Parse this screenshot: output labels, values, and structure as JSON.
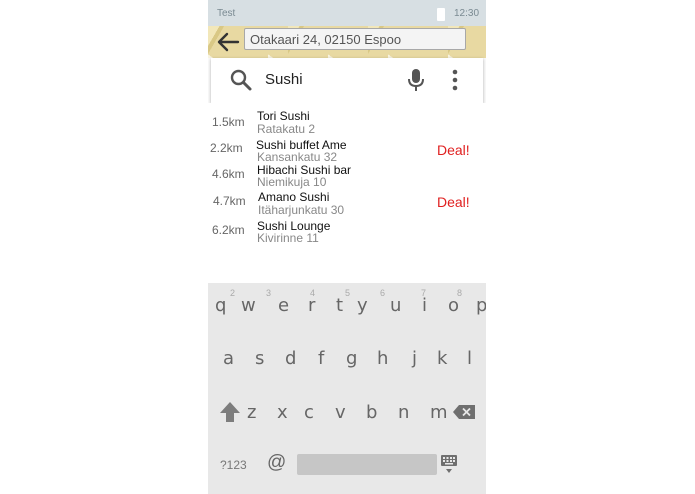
{
  "status_bar": {
    "app_label": "Test",
    "time": "12:30"
  },
  "header": {
    "address": "Otakaari 24, 02150 Espoo"
  },
  "search": {
    "query": "Sushi"
  },
  "results": [
    {
      "distance": "1.5km",
      "name": "Tori Sushi",
      "address": "Ratakatu 2",
      "deal": ""
    },
    {
      "distance": "2.2km",
      "name": "Sushi buffet Ame",
      "address": "Kansankatu 32",
      "deal": "Deal!"
    },
    {
      "distance": "4.6km",
      "name": "Hibachi Sushi bar",
      "address": "Niemikuja 10",
      "deal": ""
    },
    {
      "distance": "4.7km",
      "name": "Amano Sushi",
      "address": "Itäharjunkatu 30",
      "deal": "Deal!"
    },
    {
      "distance": "6.2km",
      "name": "Sushi Lounge",
      "address": "Kivirinne 11",
      "deal": ""
    }
  ],
  "keyboard": {
    "row1": [
      "q",
      "w",
      "e",
      "r",
      "t",
      "y",
      "u",
      "i",
      "o",
      "p"
    ],
    "row1_hints": [
      "2",
      "3",
      "4",
      "5",
      "6",
      "7",
      "8"
    ],
    "row2": [
      "a",
      "s",
      "d",
      "f",
      "g",
      "h",
      "j",
      "k",
      "l"
    ],
    "row3": [
      "z",
      "x",
      "c",
      "v",
      "b",
      "n",
      "m"
    ],
    "symbols_label": "?123",
    "at_label": "@"
  },
  "icons": {
    "back": "arrow-left-icon",
    "search": "search-icon",
    "mic": "microphone-icon",
    "more": "overflow-menu-icon",
    "shift": "shift-arrow-icon",
    "backspace": "backspace-icon",
    "keyboard": "keyboard-icon",
    "battery": "battery-icon"
  },
  "colors": {
    "deal": "#e02020",
    "status_bar": "#d7dfe3",
    "keyboard_bg": "#e8e8e8"
  }
}
